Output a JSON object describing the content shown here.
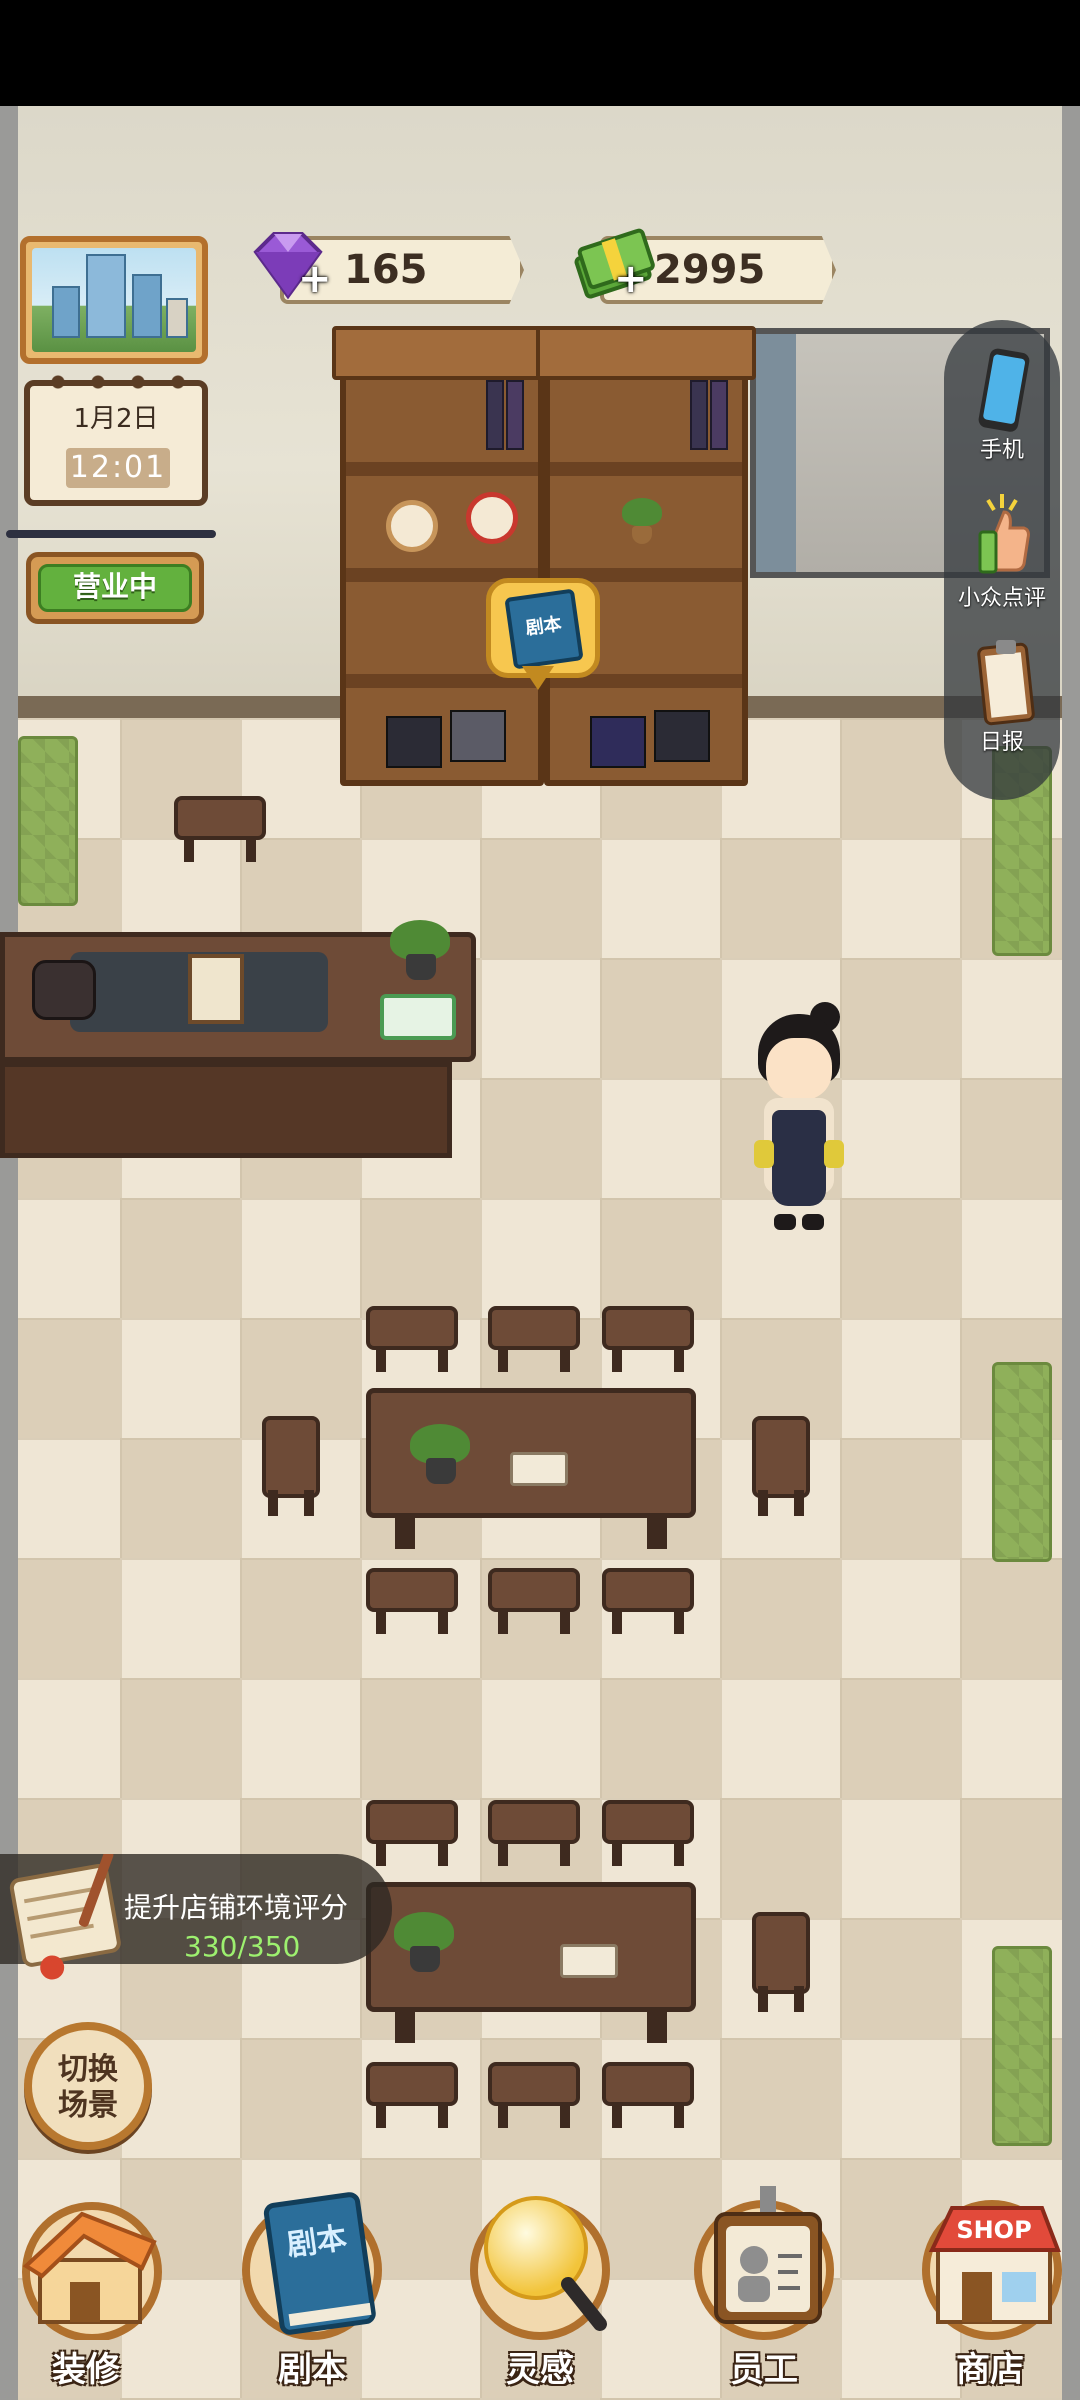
{
  "hud": {
    "gems": "165",
    "cash": "2995",
    "plus": "+",
    "date": "1月2日",
    "time": "12:01",
    "status": "营业中"
  },
  "bubble": {
    "book_text": "剧本"
  },
  "side_menu": [
    {
      "label": "手机",
      "icon": "phone-icon"
    },
    {
      "label": "小众点评",
      "icon": "thumbs-up-icon"
    },
    {
      "label": "日报",
      "icon": "clipboard-icon"
    }
  ],
  "task": {
    "title": "提升店铺环境评分",
    "progress": "330/350"
  },
  "switch_scene": "切换\n场景",
  "nav": [
    {
      "label": "装修",
      "icon": "house-icon"
    },
    {
      "label": "剧本",
      "icon": "script-book-icon",
      "icon_text": "剧本"
    },
    {
      "label": "灵感",
      "icon": "lightbulb-icon"
    },
    {
      "label": "员工",
      "icon": "staff-badge-icon"
    },
    {
      "label": "商店",
      "icon": "shop-icon",
      "icon_text": "SHOP"
    }
  ],
  "colors": {
    "accent_wood": "#b3702d",
    "open_green": "#63b13e",
    "task_green": "#9df06f"
  }
}
